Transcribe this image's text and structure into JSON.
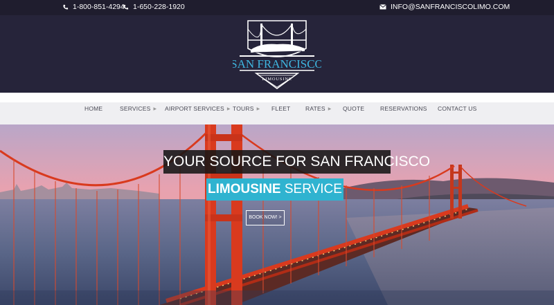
{
  "topbar": {
    "phone1": "1-800-851-4294",
    "phone2": "1-650-228-1920",
    "email": "INFO@SANFRANCISCOLIMO.COM",
    "phone_icon": "phone-icon",
    "email_icon": "envelope-icon"
  },
  "logo": {
    "title": "SAN FRANCISCO",
    "subtitle": "LIMOUSINE",
    "title_color": "#3fb6e0"
  },
  "nav": {
    "items": [
      {
        "label": "HOME",
        "dropdown": false
      },
      {
        "label": "SERVICES",
        "dropdown": true
      },
      {
        "label": "AIRPORT SERVICES",
        "dropdown": true
      },
      {
        "label": "TOURS",
        "dropdown": true
      },
      {
        "label": "FLEET",
        "dropdown": false
      },
      {
        "label": "RATES",
        "dropdown": true
      },
      {
        "label": "QUOTE",
        "dropdown": false
      },
      {
        "label": "RESERVATIONS",
        "dropdown": false
      },
      {
        "label": "CONTACT US",
        "dropdown": false
      }
    ]
  },
  "hero": {
    "headline": "YOUR SOURCE FOR SAN FRANCISCO",
    "subhead_bold": "LIMOUSINE",
    "subhead_rest": " SERVICE",
    "cta": "BOOK NOW! >",
    "accent": "#2fb3d0",
    "bridge_color": "#d93a1e"
  }
}
